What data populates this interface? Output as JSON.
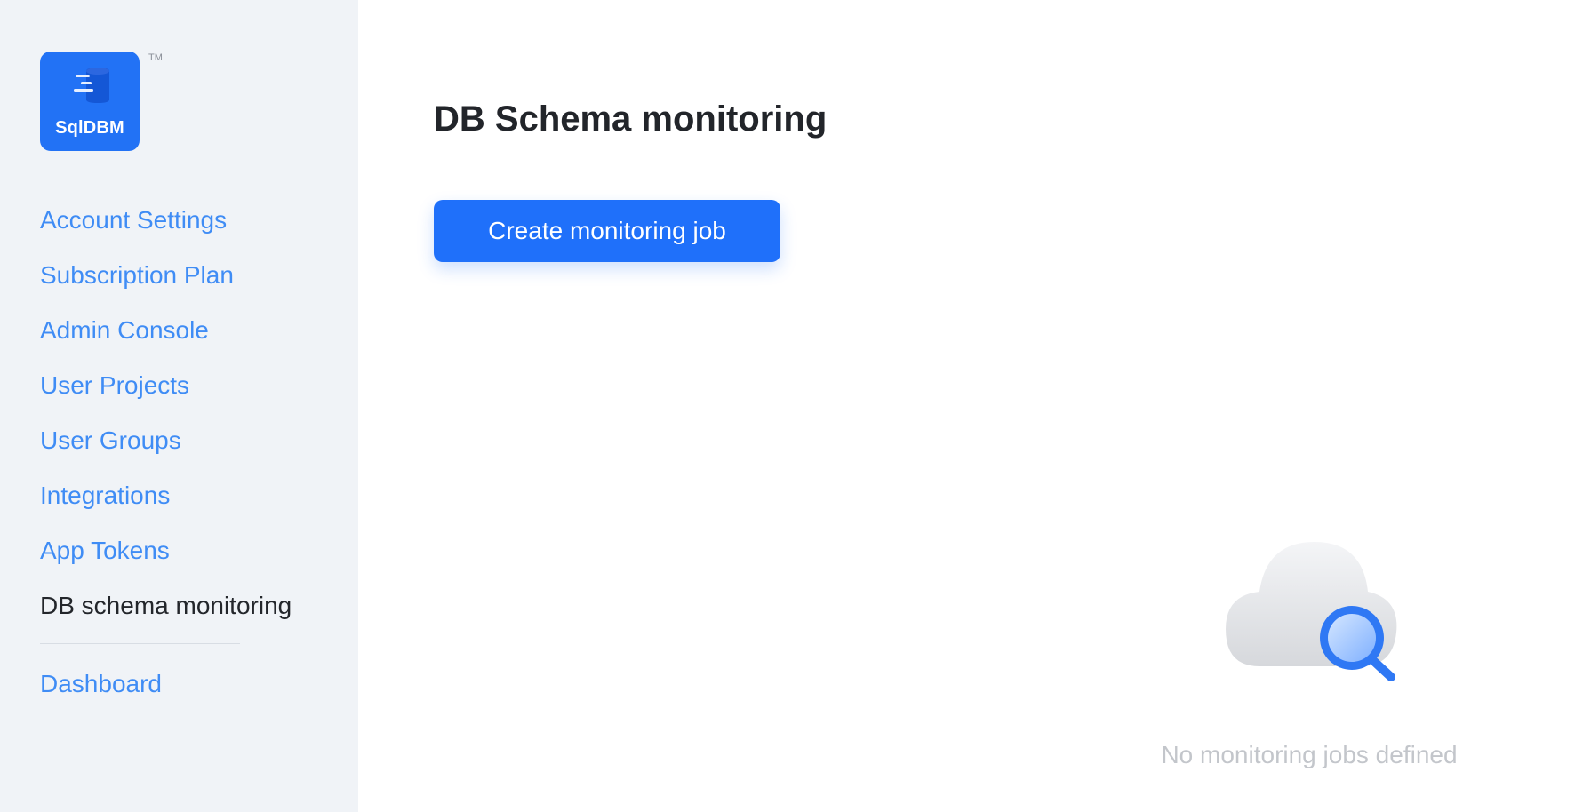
{
  "sidebar": {
    "logo": {
      "text": "SqlDBM",
      "tm": "TM",
      "color": "#2272f5"
    },
    "items": [
      {
        "label": "Account Settings"
      },
      {
        "label": "Subscription Plan"
      },
      {
        "label": "Admin Console"
      },
      {
        "label": "User Projects"
      },
      {
        "label": "User Groups"
      },
      {
        "label": "Integrations"
      },
      {
        "label": "App Tokens"
      },
      {
        "label": "DB schema monitoring",
        "active": true
      }
    ],
    "secondary": [
      {
        "label": "Dashboard"
      }
    ]
  },
  "main": {
    "title": "DB Schema monitoring",
    "create_button_label": "Create monitoring job",
    "empty_state": {
      "message": "No monitoring jobs defined",
      "icon": "cloud-search-icon"
    }
  },
  "colors": {
    "accent": "#1f70fa",
    "link": "#3f8cf5",
    "sidebar_bg": "#f0f3f7",
    "text_dark": "#22252a",
    "muted": "#c3c6cb"
  }
}
